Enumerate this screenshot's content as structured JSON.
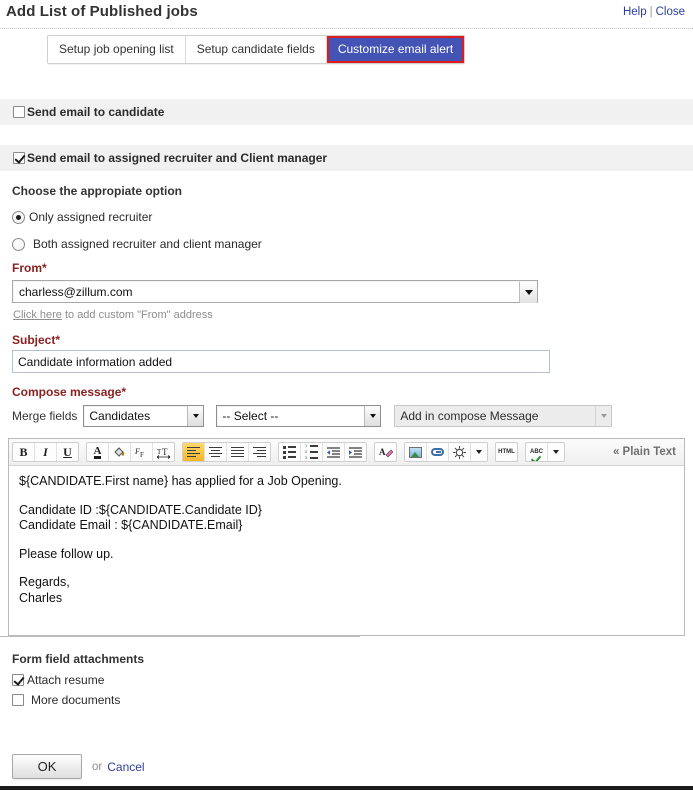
{
  "header": {
    "title": "Add List of Published jobs",
    "help_label": "Help",
    "separator": "|",
    "close_label": "Close"
  },
  "tabs": [
    {
      "label": "Setup job opening list",
      "active": false
    },
    {
      "label": "Setup candidate fields",
      "active": false
    },
    {
      "label": "Customize email alert",
      "active": true
    }
  ],
  "options": {
    "send_to_candidate": {
      "label": "Send email to candidate",
      "checked": false
    },
    "send_to_recruiter": {
      "label": "Send email to assigned recruiter and Client manager",
      "checked": true
    },
    "choose_label": "Choose the appropiate option",
    "radios": [
      {
        "label": "Only assigned recruiter",
        "selected": true
      },
      {
        "label": "Both assigned recruiter and client manager",
        "selected": false
      }
    ]
  },
  "from": {
    "label": "From*",
    "value": "charless@zillum.com",
    "hint_link": "Click here",
    "hint_rest": " to add custom \"From\" address"
  },
  "subject": {
    "label": "Subject*",
    "value": "Candidate information added",
    "placeholder": ""
  },
  "compose": {
    "label": "Compose message*",
    "merge_fields_label": "Merge fields",
    "module_select": "Candidates",
    "field_select": "-- Select --",
    "add_button": "Add in compose Message",
    "plain_text_label": "« Plain Text",
    "body_lines": [
      "${CANDIDATE.First name} has applied for a Job Opening.",
      "Candidate ID :${CANDIDATE.Candidate ID}",
      "Candidate Email : ${CANDIDATE.Email}",
      "Please follow up.",
      "Regards,",
      "Charles"
    ]
  },
  "toolbar": {
    "bold": "B",
    "italic": "I",
    "underline": "U",
    "font_color": "A",
    "highlight": "paint-bucket",
    "font_format": "F",
    "font_size": "T",
    "align_left": "align-left",
    "align_center": "align-center",
    "align_justify": "align-justify",
    "align_right": "align-right",
    "bullet_list": "bullet-list",
    "numbered_list": "numbered-list",
    "indent_decrease": "outdent",
    "indent_increase": "indent",
    "clear_format": "clear-format",
    "insert_image": "image",
    "insert_link": "link",
    "insert_emoticon": "emoticon",
    "more_caret": "caret",
    "html_source": "HTML",
    "spellcheck": "ABC",
    "spell_caret": "caret"
  },
  "attachments": {
    "label": "Form field attachments",
    "items": [
      {
        "label": "Attach resume",
        "checked": true
      },
      {
        "label": "More documents",
        "checked": false
      }
    ]
  },
  "footer": {
    "ok_label": "OK",
    "or_label": "or",
    "cancel_label": "Cancel"
  },
  "colors": {
    "active_tab_bg": "#4354b5",
    "active_tab_outline": "#e01b1b",
    "required_label": "#8b2121",
    "link": "#2b3f9e",
    "band_bg": "#f1f1f1",
    "toolbar_active": "#f5b62c"
  }
}
